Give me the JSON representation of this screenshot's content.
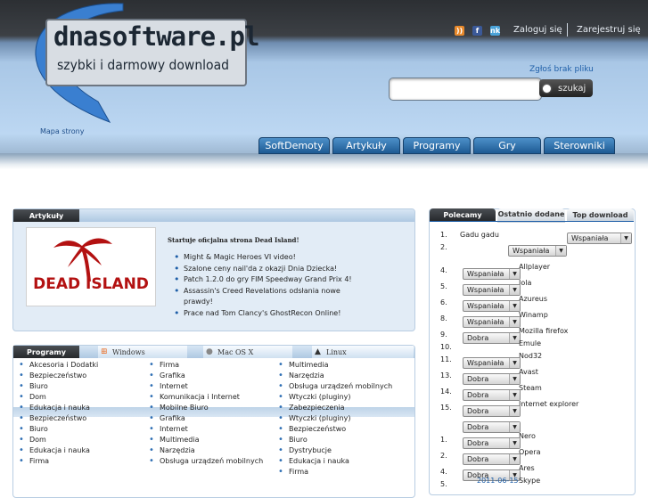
{
  "header": {
    "logo_title": "dnasoftware.pl",
    "logo_subtitle": "szybki i darmowy download",
    "sitemap": "Mapa strony",
    "login": "Zaloguj się",
    "register": "Zarejestruj się",
    "report": "Zgłoś brak pliku",
    "search_button": "szukaj",
    "search_placeholder": "",
    "icons": [
      "rss-icon",
      "facebook-icon",
      "nk-icon"
    ]
  },
  "nav": {
    "tabs": [
      "SoftDemoty",
      "Artykuły",
      "Programy",
      "Gry",
      "Sterowniki"
    ]
  },
  "articles": {
    "tab": "Artykuły",
    "image_text": "DEAD ISLAND",
    "headline": "Startuje oficjalna strona Dead Island!",
    "items": [
      "Might & Magic Heroes VI video!",
      "Szalone ceny nail'da z okazji Dnia Dziecka!",
      "Patch 1.2.0 do gry FIM Speedway Grand Prix 4!",
      "Assassin's Creed Revelations odsłania nowe prawdy!",
      "Prace nad Tom Clancy's GhostRecon Online!"
    ]
  },
  "programs": {
    "tab": "Programy",
    "os_tabs": [
      "Windows",
      "Mac OS X",
      "Linux"
    ],
    "col1": [
      "Akcesoria i Dodatki",
      "Bezpieczeństwo",
      "Biuro",
      "Dom",
      "Edukacja i nauka",
      "Bezpieczeństwo",
      "Biuro",
      "Dom",
      "Edukacja i nauka",
      "Firma"
    ],
    "col2": [
      "Firma",
      "Grafika",
      "Internet",
      "Komunikacja i Internet",
      "Mobilne Biuro",
      "Grafika",
      "Internet",
      "Multimedia",
      "Narzędzia",
      "Obsługa urządzeń mobilnych"
    ],
    "col3": [
      "Multimedia",
      "Narzędzia",
      "Obsługa urządzeń mobilnych",
      "Wtyczki (pluginy)",
      "Zabezpieczenia",
      "Wtyczki (pluginy)",
      "Bezpieczeństwo",
      "Biuro",
      "Dystrybucje",
      "Edukacja i nauka",
      "Firma"
    ]
  },
  "sidebar": {
    "tabs": [
      "Polecamy",
      "Ostatnio dodane",
      "Top download"
    ],
    "ranks": [
      {
        "num": "1.",
        "name": "Gadu gadu",
        "rating": "Wspaniała"
      },
      {
        "num": "2.",
        "name": "",
        "rating": "Wspaniała"
      },
      {
        "num": "4.",
        "name": "Allplayer",
        "rating": "Wspaniała"
      },
      {
        "num": "5.",
        "name": "Jola",
        "rating": "Wspaniała"
      },
      {
        "num": "6.",
        "name": "Azureus",
        "rating": "Wspaniała"
      },
      {
        "num": "8.",
        "name": "Winamp",
        "rating": "Wspaniała"
      },
      {
        "num": "9.",
        "name": "Mozilla firefox",
        "rating": "Dobra"
      },
      {
        "num": "10.",
        "name": "Emule",
        "rating": ""
      },
      {
        "num": "11.",
        "name": "Nod32",
        "rating": "Wspaniała"
      },
      {
        "num": "13.",
        "name": "Avast",
        "rating": "Dobra"
      },
      {
        "num": "14.",
        "name": "Steam",
        "rating": "Dobra"
      },
      {
        "num": "15.",
        "name": "Internet explorer",
        "rating": "Dobra"
      },
      {
        "num": "",
        "name": "",
        "rating": "Dobra"
      },
      {
        "num": "1.",
        "name": "Nero",
        "rating": "Dobra"
      },
      {
        "num": "2.",
        "name": "Opera",
        "rating": "Dobra"
      },
      {
        "num": "4.",
        "name": "Ares",
        "rating": "Dobra"
      },
      {
        "num": "5.",
        "name": "Skype",
        "rating": ""
      }
    ],
    "date": "2011-06-15"
  }
}
